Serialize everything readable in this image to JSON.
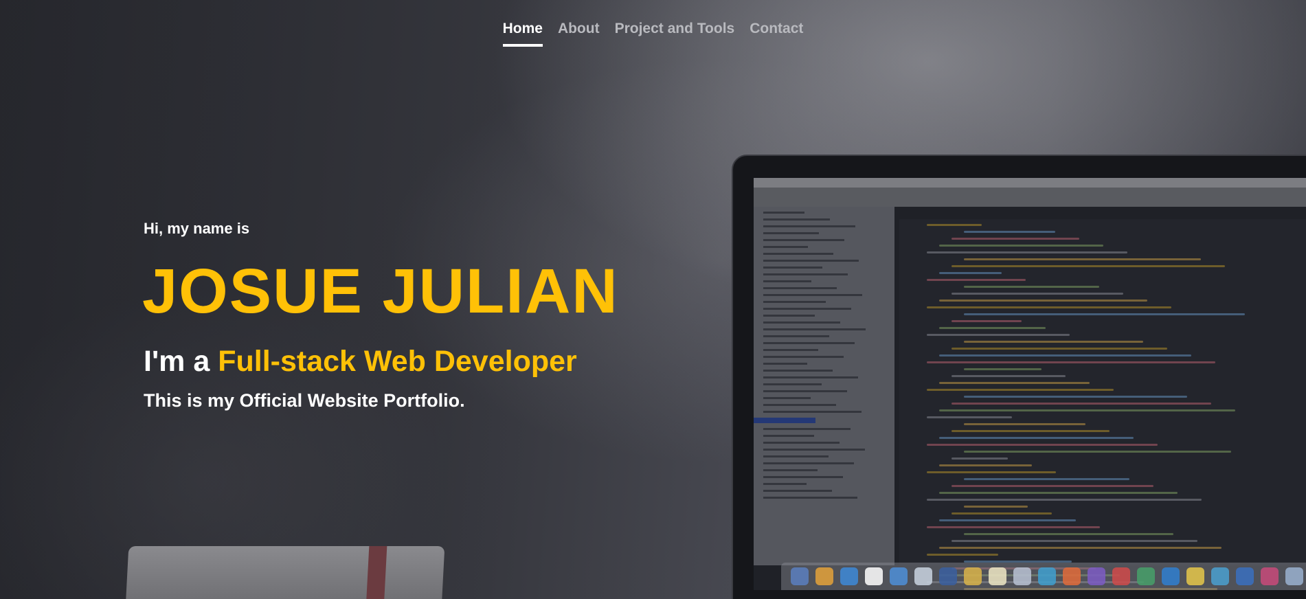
{
  "nav": {
    "items": [
      {
        "label": "Home",
        "active": true
      },
      {
        "label": "About",
        "active": false
      },
      {
        "label": "Project and Tools",
        "active": false
      },
      {
        "label": "Contact",
        "active": false
      }
    ]
  },
  "hero": {
    "intro": "Hi, my name is",
    "name": "JOSUE JULIAN",
    "role_prefix": "I'm a",
    "role_highlight": "Full-stack Web Developer",
    "tagline": "This is my Official Website Portfolio."
  },
  "colors": {
    "accent": "#ffc107",
    "text": "#ffffff",
    "nav_inactive": "#b9babf"
  },
  "background": {
    "icons": [
      "laptop-image",
      "book-image"
    ]
  }
}
